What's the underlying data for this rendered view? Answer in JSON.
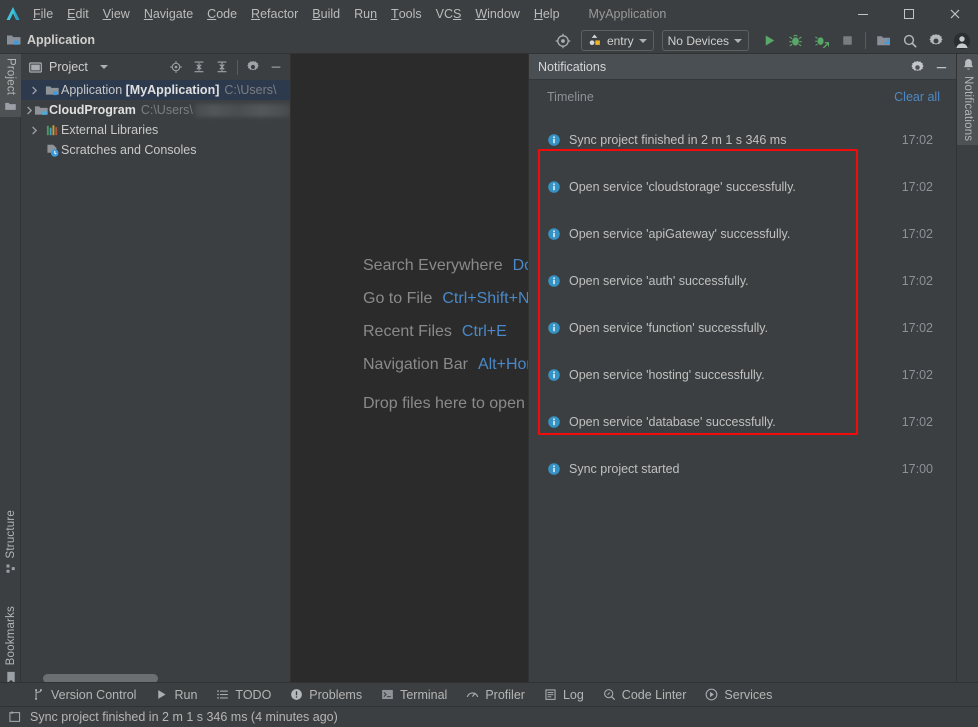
{
  "window": {
    "app_title": "MyApplication",
    "minimize_label": "—",
    "maximize_label": "☐",
    "close_label": "✕"
  },
  "menubar": {
    "logo": "ide-logo-icon",
    "items": [
      {
        "label": "File",
        "mnemonic": "F"
      },
      {
        "label": "Edit",
        "mnemonic": "E"
      },
      {
        "label": "View",
        "mnemonic": "V"
      },
      {
        "label": "Navigate",
        "mnemonic": "N"
      },
      {
        "label": "Code",
        "mnemonic": "C"
      },
      {
        "label": "Refactor",
        "mnemonic": "R"
      },
      {
        "label": "Build",
        "mnemonic": "B"
      },
      {
        "label": "Run",
        "mnemonic": "n"
      },
      {
        "label": "Tools",
        "mnemonic": "T"
      },
      {
        "label": "VCS",
        "mnemonic": "S"
      },
      {
        "label": "Window",
        "mnemonic": "W"
      },
      {
        "label": "Help",
        "mnemonic": "H"
      }
    ]
  },
  "toolbar": {
    "project_name": "Application",
    "run_config": "entry",
    "device_selector": "No Devices",
    "icons": {
      "target": "crosshair-icon",
      "run": "run-icon",
      "debug": "debug-icon",
      "attach_debug": "attach-debugger-icon",
      "stop": "stop-icon",
      "project_structure": "project-structure-icon",
      "search": "search-icon",
      "settings": "gear-icon",
      "account": "account-avatar-icon"
    }
  },
  "left_stripe": {
    "top_tabs": [
      {
        "label": "Project",
        "active": true
      }
    ],
    "bottom_tabs": [
      {
        "label": "Structure"
      },
      {
        "label": "Bookmarks"
      }
    ]
  },
  "right_stripe": {
    "tabs": [
      {
        "label": "Notifications",
        "active": true
      }
    ]
  },
  "project_panel": {
    "title": "Project",
    "toolbar_icons": [
      "locate-icon",
      "expand-all-icon",
      "collapse-all-icon",
      "gear-icon",
      "hide-icon"
    ],
    "tree": [
      {
        "name": "Application",
        "bracket": "[MyApplication]",
        "path": "C:\\Users\\",
        "icon": "module-folder-icon",
        "expandable": true,
        "selected": true,
        "redacted": false
      },
      {
        "name": "CloudProgram",
        "bracket": "",
        "path": "C:\\Users\\",
        "path_suffix": "\\D",
        "icon": "cloud-module-icon",
        "expandable": true,
        "selected": false,
        "redacted": true
      },
      {
        "name": "External Libraries",
        "bracket": "",
        "path": "",
        "icon": "libraries-icon",
        "expandable": true,
        "selected": false,
        "redacted": false
      },
      {
        "name": "Scratches and Consoles",
        "bracket": "",
        "path": "",
        "icon": "scratches-icon",
        "expandable": false,
        "selected": false,
        "redacted": false
      }
    ]
  },
  "editor": {
    "hints": [
      {
        "label": "Search Everywhere",
        "shortcut": "Double Shift"
      },
      {
        "label": "Go to File",
        "shortcut": "Ctrl+Shift+N"
      },
      {
        "label": "Recent Files",
        "shortcut": "Ctrl+E"
      },
      {
        "label": "Navigation Bar",
        "shortcut": "Alt+Home"
      }
    ],
    "drop_hint": "Drop files here to open them"
  },
  "notifications": {
    "title": "Notifications",
    "header_icons": [
      "gear-icon",
      "hide-icon"
    ],
    "timeline_label": "Timeline",
    "clear_all_label": "Clear all",
    "highlight_color": "#f30b0b",
    "items": [
      {
        "text": "Sync project finished in 2 m 1 s 346 ms",
        "time": "17:02",
        "icon": "info-icon",
        "highlighted": false
      },
      {
        "text": "Open service 'cloudstorage' successfully.",
        "time": "17:02",
        "icon": "info-icon",
        "highlighted": true
      },
      {
        "text": "Open service 'apiGateway' successfully.",
        "time": "17:02",
        "icon": "info-icon",
        "highlighted": true
      },
      {
        "text": "Open service 'auth' successfully.",
        "time": "17:02",
        "icon": "info-icon",
        "highlighted": true
      },
      {
        "text": "Open service 'function' successfully.",
        "time": "17:02",
        "icon": "info-icon",
        "highlighted": true
      },
      {
        "text": "Open service 'hosting' successfully.",
        "time": "17:02",
        "icon": "info-icon",
        "highlighted": true
      },
      {
        "text": "Open service 'database' successfully.",
        "time": "17:02",
        "icon": "info-icon",
        "highlighted": true
      },
      {
        "text": "Sync project started",
        "time": "17:00",
        "icon": "info-icon",
        "highlighted": false
      }
    ]
  },
  "bottom_bar": {
    "items": [
      {
        "label": "Version Control",
        "icon": "branch-icon"
      },
      {
        "label": "Run",
        "icon": "run-icon"
      },
      {
        "label": "TODO",
        "icon": "todo-icon"
      },
      {
        "label": "Problems",
        "icon": "problems-icon"
      },
      {
        "label": "Terminal",
        "icon": "terminal-icon"
      },
      {
        "label": "Profiler",
        "icon": "profiler-icon"
      },
      {
        "label": "Log",
        "icon": "log-icon"
      },
      {
        "label": "Code Linter",
        "icon": "code-linter-icon"
      },
      {
        "label": "Services",
        "icon": "services-icon"
      }
    ]
  },
  "status_bar": {
    "icon": "event-log-icon",
    "text": "Sync project finished in 2 m 1 s 346 ms (4 minutes ago)"
  }
}
